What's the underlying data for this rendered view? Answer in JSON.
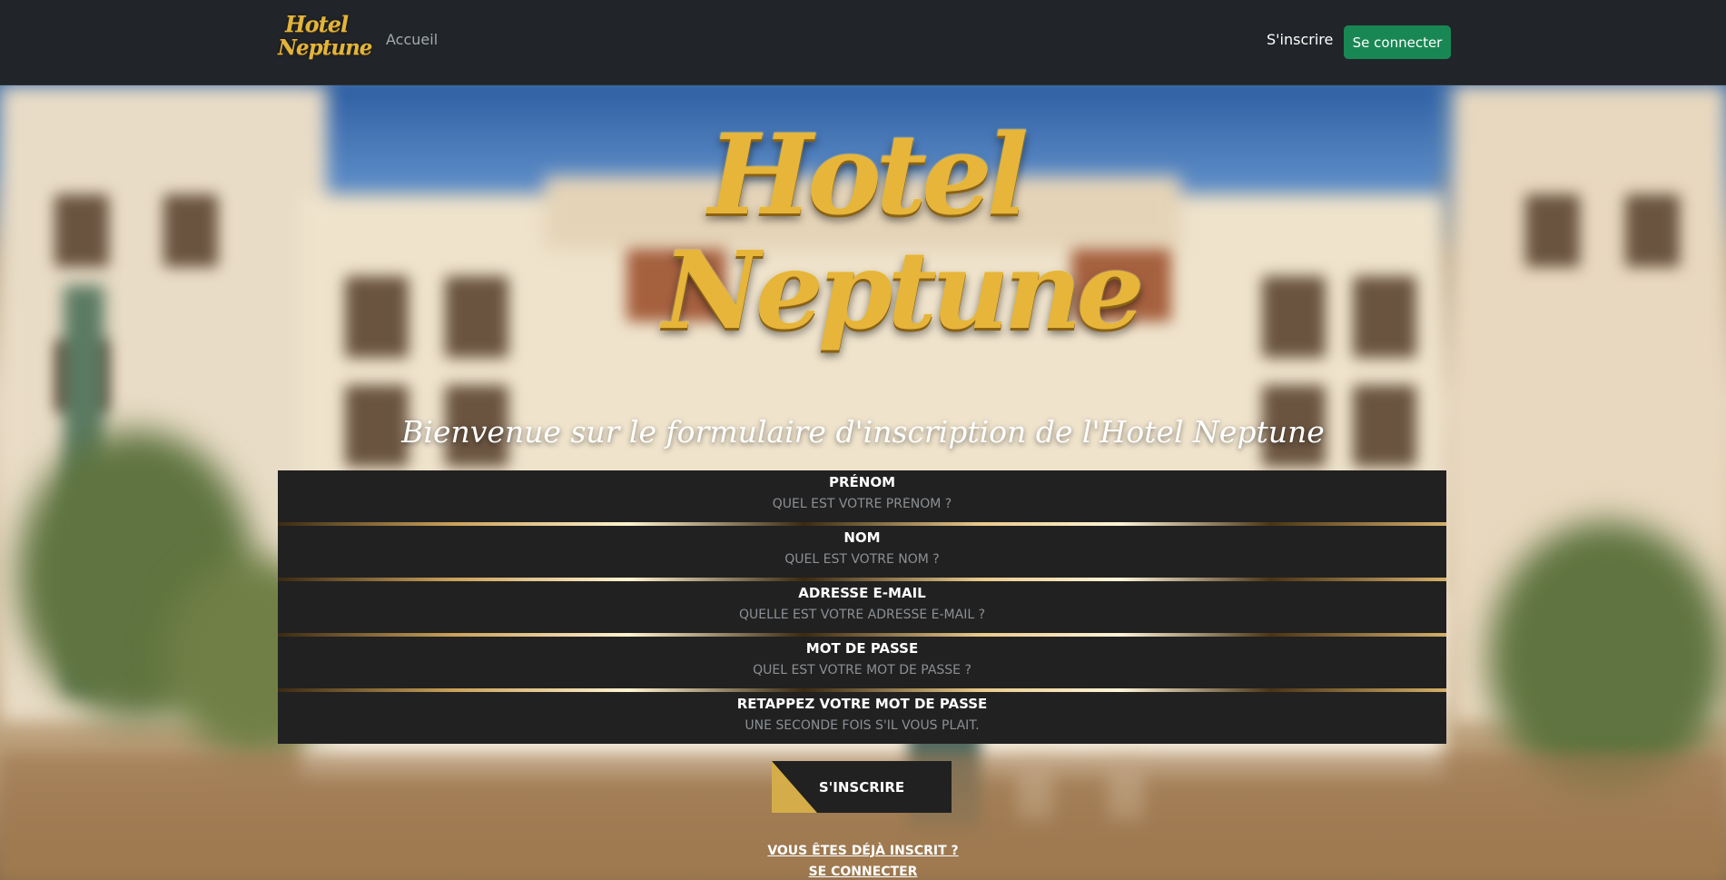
{
  "navbar": {
    "logo": {
      "line1": "Hotel",
      "line2": "Neptune"
    },
    "home_link": "Accueil",
    "signup_link": "S'inscrire",
    "login_button": "Se connecter"
  },
  "hero": {
    "logo": {
      "line1": "Hotel",
      "line2": "Neptune"
    },
    "welcome": "Bienvenue sur le formulaire d'inscription de l'Hotel Neptune"
  },
  "form": {
    "fields": [
      {
        "label": "Prénom",
        "placeholder": "Quel est votre prénom ?"
      },
      {
        "label": "Nom",
        "placeholder": "Quel est votre nom ?"
      },
      {
        "label": "Adresse e-mail",
        "placeholder": "Quelle est votre adresse e-mail ?"
      },
      {
        "label": "Mot de passe",
        "placeholder": "Quel est votre mot de passe ?"
      },
      {
        "label": "Retappez votre mot de passe",
        "placeholder": "Une seconde fois s'il vous plait."
      }
    ],
    "submit_label": "S'inscrire",
    "already_registered": "Vous êtes déjà inscrit ?",
    "login_link": "Se connecter"
  },
  "colors": {
    "navbar_bg": "#212529",
    "accent_green": "#198754",
    "gold": "#e6b53a",
    "field_bg": "#212121"
  }
}
